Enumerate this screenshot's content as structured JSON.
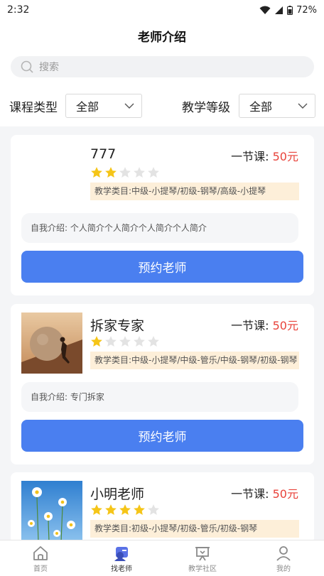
{
  "status": {
    "time": "2:32",
    "battery": "72%"
  },
  "header": {
    "title": "老师介绍"
  },
  "search": {
    "placeholder": "搜索"
  },
  "filters": {
    "course_type_label": "课程类型",
    "course_type_value": "全部",
    "level_label": "教学等级",
    "level_value": "全部"
  },
  "price_label": "一节课: ",
  "book_label": "预约老师",
  "teachers": [
    {
      "name": "777",
      "rating": 2,
      "price": "50元",
      "categories": "教学类目:中级-小提琴/初级-钢琴/高级-小提琴",
      "intro": "自我介绍: 个人简介个人简介个人简介个人简介",
      "avatar": "none"
    },
    {
      "name": "拆家专家",
      "rating": 1,
      "price": "50元",
      "categories": "教学类目:中级-小提琴/中级-管乐/中级-钢琴/初级-钢琴",
      "intro": "自我介绍: 专门拆家",
      "avatar": "boulder"
    },
    {
      "name": "小明老师",
      "rating": 4,
      "price": "50元",
      "categories": "教学类目:初级-小提琴/初级-管乐/初级-钢琴",
      "intro": "",
      "avatar": "daisies"
    }
  ],
  "colors": {
    "accent": "#4a7ff0",
    "price": "#e8423a",
    "star_on": "#f5c518",
    "star_off": "#e3e3e3",
    "tag_bg": "#fdefd9"
  },
  "tabbar": [
    {
      "label": "首页",
      "icon": "home-icon",
      "active": false
    },
    {
      "label": "找老师",
      "icon": "find-teacher-icon",
      "active": true
    },
    {
      "label": "教学社区",
      "icon": "community-icon",
      "active": false
    },
    {
      "label": "我的",
      "icon": "profile-icon",
      "active": false
    }
  ]
}
